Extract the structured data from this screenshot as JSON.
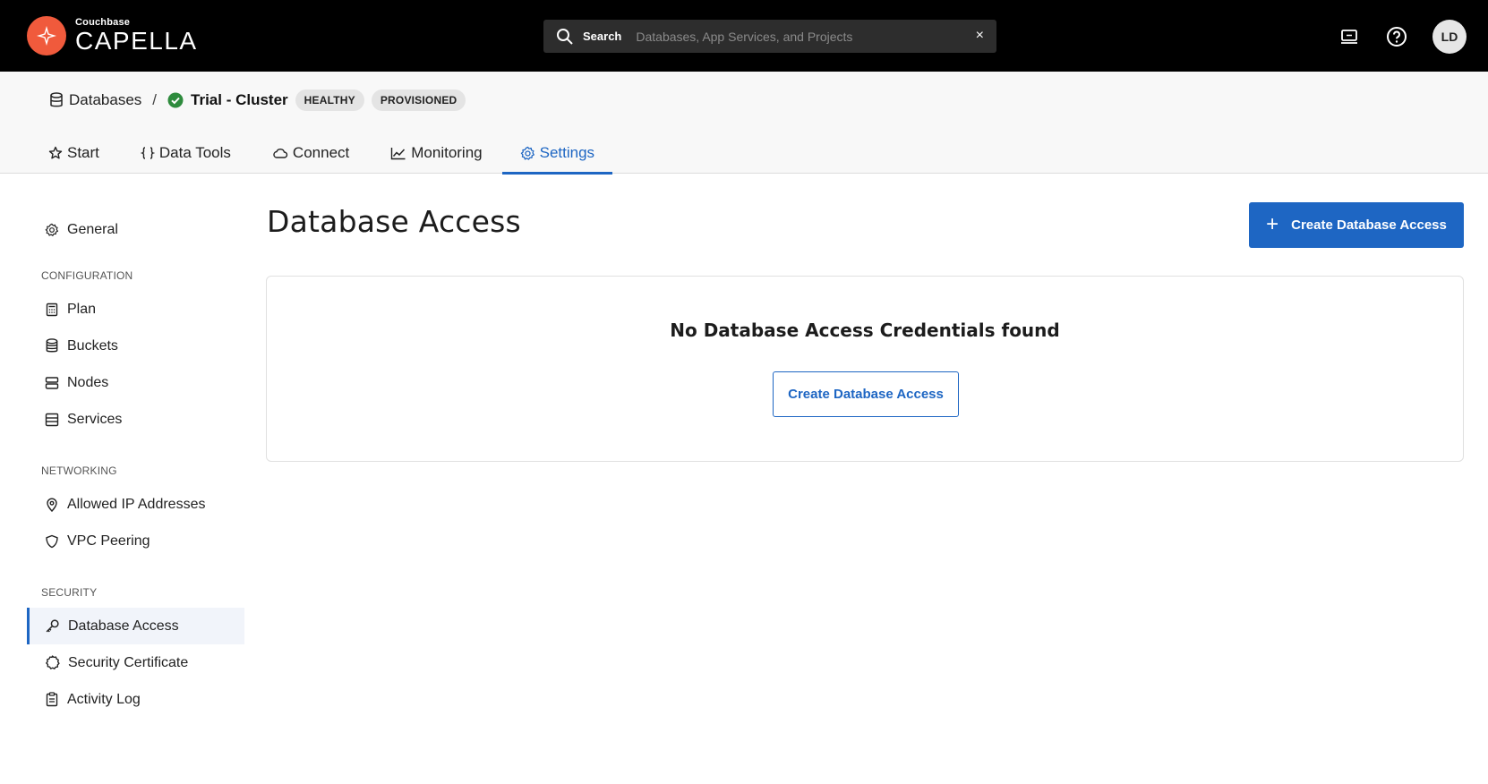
{
  "app": {
    "brand_small": "Couchbase",
    "brand_big": "CAPELLA"
  },
  "search": {
    "label": "Search",
    "placeholder": "Databases, App Services, and Projects",
    "clear": "×"
  },
  "user": {
    "initials": "LD"
  },
  "breadcrumb": {
    "root": "Databases",
    "separator": "/",
    "cluster": "Trial - Cluster",
    "badges": [
      "HEALTHY",
      "PROVISIONED"
    ]
  },
  "tabs": [
    {
      "label": "Start",
      "icon": "star-icon"
    },
    {
      "label": "Data Tools",
      "icon": "braces-icon"
    },
    {
      "label": "Connect",
      "icon": "cloud-icon"
    },
    {
      "label": "Monitoring",
      "icon": "chart-line-icon"
    },
    {
      "label": "Settings",
      "icon": "gear-icon",
      "active": true
    }
  ],
  "sidebar": {
    "general": "General",
    "sections": [
      {
        "title": "CONFIGURATION",
        "items": [
          "Plan",
          "Buckets",
          "Nodes",
          "Services"
        ]
      },
      {
        "title": "NETWORKING",
        "items": [
          "Allowed IP Addresses",
          "VPC Peering"
        ]
      },
      {
        "title": "SECURITY",
        "items": [
          "Database Access",
          "Security Certificate",
          "Activity Log"
        ]
      }
    ],
    "active": "Database Access"
  },
  "main": {
    "title": "Database Access",
    "create_button": "Create Database Access",
    "empty_title": "No Database Access Credentials found",
    "empty_button": "Create Database Access"
  },
  "colors": {
    "accent": "#1e66c3",
    "topbar": "#000000",
    "brand": "#f05a3c",
    "healthy": "#2e8b3d"
  }
}
